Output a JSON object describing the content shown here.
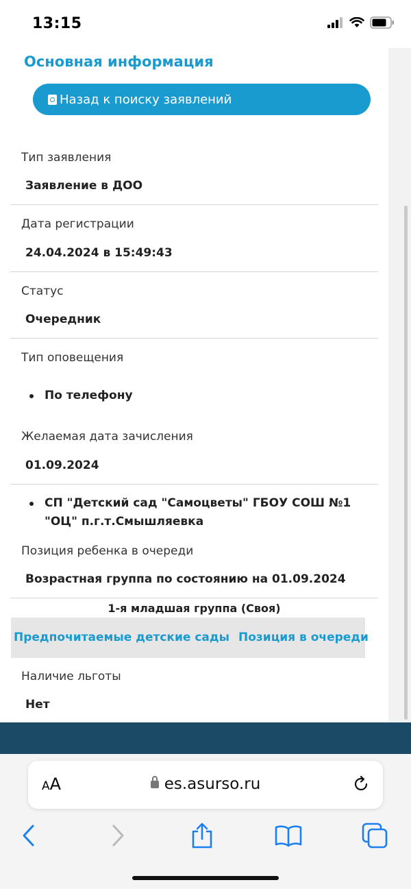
{
  "status_bar": {
    "time": "13:15"
  },
  "section_title": "Основная информация",
  "back_button_label": "Назад к поиску заявлений",
  "fields": {
    "type": {
      "label": "Тип заявления",
      "value": "Заявление в ДОО"
    },
    "reg_date": {
      "label": "Дата регистрации",
      "value": "24.04.2024 в 15:49:43"
    },
    "status": {
      "label": "Статус",
      "value": "Очередник"
    },
    "notify": {
      "label": "Тип оповещения",
      "items": [
        "По телефону"
      ]
    },
    "desired_date": {
      "label": "Желаемая дата зачисления",
      "value": "01.09.2024"
    },
    "kindergartens": {
      "items": [
        "СП \"Детский сад \"Самоцветы\" ГБОУ СОШ №1 \"ОЦ\" п.г.т.Смышляевка"
      ]
    },
    "queue_position": {
      "label": "Позиция ребенка в очереди",
      "value": "Возрастная группа по состоянию на 01.09.2024"
    },
    "group": {
      "value": "1-я младшая группа (Своя)"
    },
    "benefit": {
      "label": "Наличие льготы",
      "value": "Нет"
    }
  },
  "tabs": [
    "Предпочитаемые детские сады",
    "Позиция в очереди"
  ],
  "browser": {
    "text_size_label_small": "A",
    "text_size_label_large": "A",
    "url": "es.asurso.ru"
  },
  "colors": {
    "accent": "#1a9bd0",
    "footer": "#1b4a66"
  }
}
